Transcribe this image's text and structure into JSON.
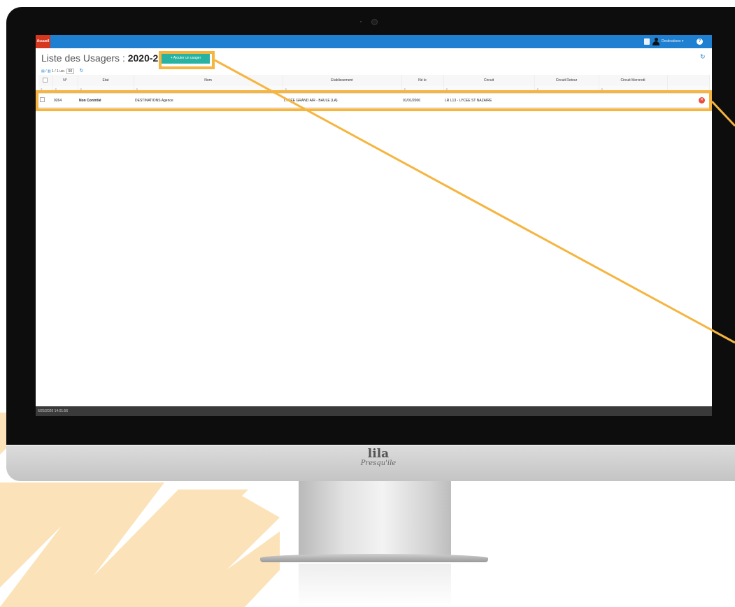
{
  "topbar": {
    "home_label": "Accueil",
    "user_label": "Destinations ▾"
  },
  "page": {
    "title_prefix": "Liste des Usagers : ",
    "title_year": "2020-2021",
    "add_button": "+ Ajouter un usager",
    "pager_text": "1 / 1 usr.",
    "page_size": "50"
  },
  "table": {
    "columns": [
      "",
      "N°",
      "Etat",
      "Nom",
      "Etablissement",
      "Né le",
      "Circuit",
      "Circuit Retour",
      "Circuit Mercredi",
      ""
    ],
    "rows": [
      {
        "id": "9264",
        "etat": "Non Contrôlé",
        "nom": "DESTINATIONS Agence",
        "etablissement": "LYCÉE GRAND AIR - BAULE (LA)",
        "ne_le": "01/01/2006",
        "circuit": "LR L13 - LYCEE ST NAZAIRE",
        "circuit_retour": "",
        "circuit_mercredi": ""
      }
    ]
  },
  "statusbar": {
    "text": "6/25/2020 14:01:56"
  },
  "brand": {
    "logo_main": "lila",
    "logo_sub": "Presqu'ile"
  },
  "colors": {
    "topbar": "#1f7fd1",
    "home": "#d6371f",
    "add_button": "#27b2a1",
    "highlight": "#f5b540",
    "danger": "#e74c3c"
  }
}
